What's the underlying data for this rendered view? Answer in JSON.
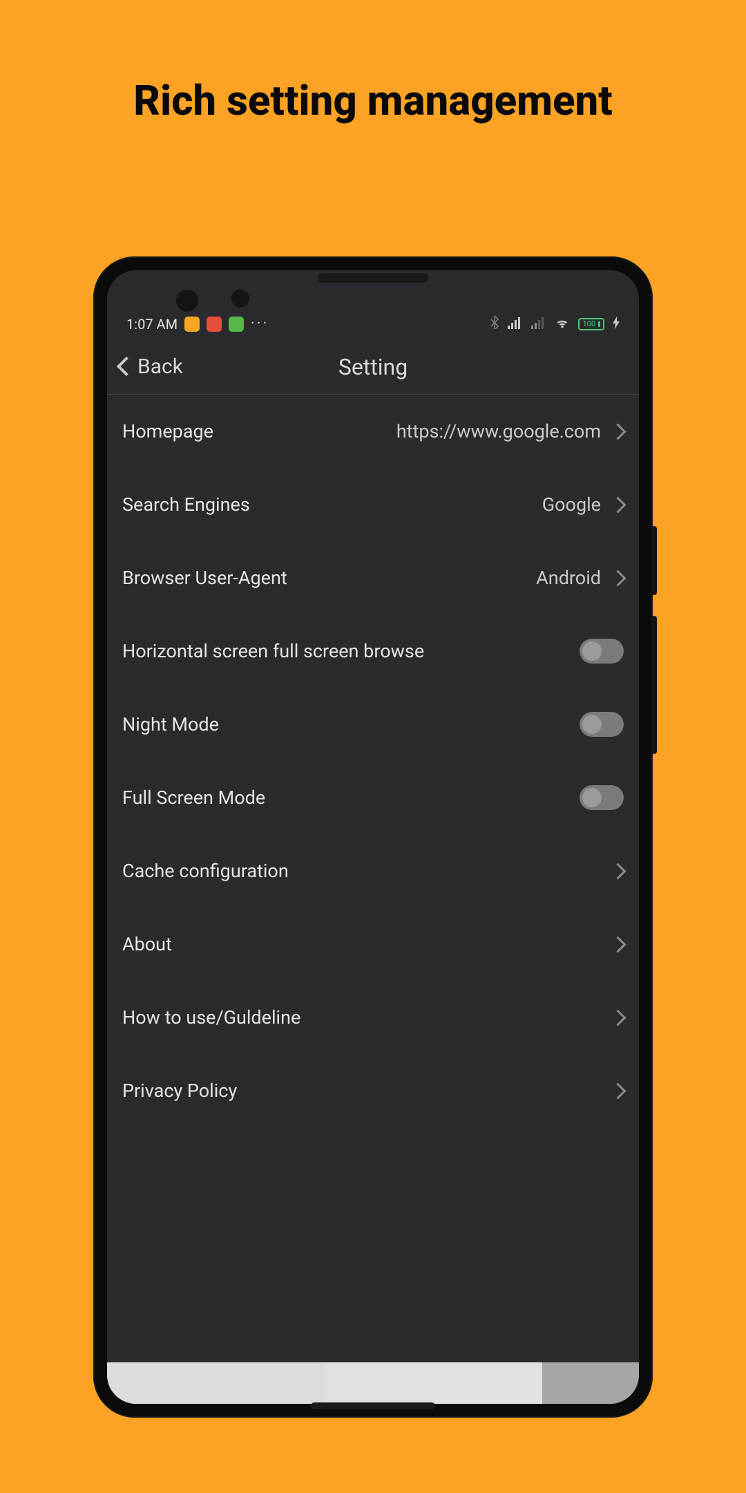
{
  "headline": "Rich setting management",
  "status": {
    "time": "1:07 AM",
    "battery": "100",
    "bolt": "⚡"
  },
  "nav": {
    "back": "Back",
    "title": "Setting"
  },
  "settings": {
    "homepage": {
      "label": "Homepage",
      "value": "https://www.google.com"
    },
    "search_engines": {
      "label": "Search Engines",
      "value": "Google"
    },
    "user_agent": {
      "label": "Browser User-Agent",
      "value": "Android"
    },
    "horizontal_full": {
      "label": "Horizontal screen full screen browse"
    },
    "night_mode": {
      "label": "Night Mode"
    },
    "full_screen": {
      "label": "Full Screen Mode"
    },
    "cache_config": {
      "label": "Cache configuration"
    },
    "about": {
      "label": "About"
    },
    "guideline": {
      "label": "How to use/Guldeline"
    },
    "privacy": {
      "label": "Privacy Policy"
    }
  }
}
